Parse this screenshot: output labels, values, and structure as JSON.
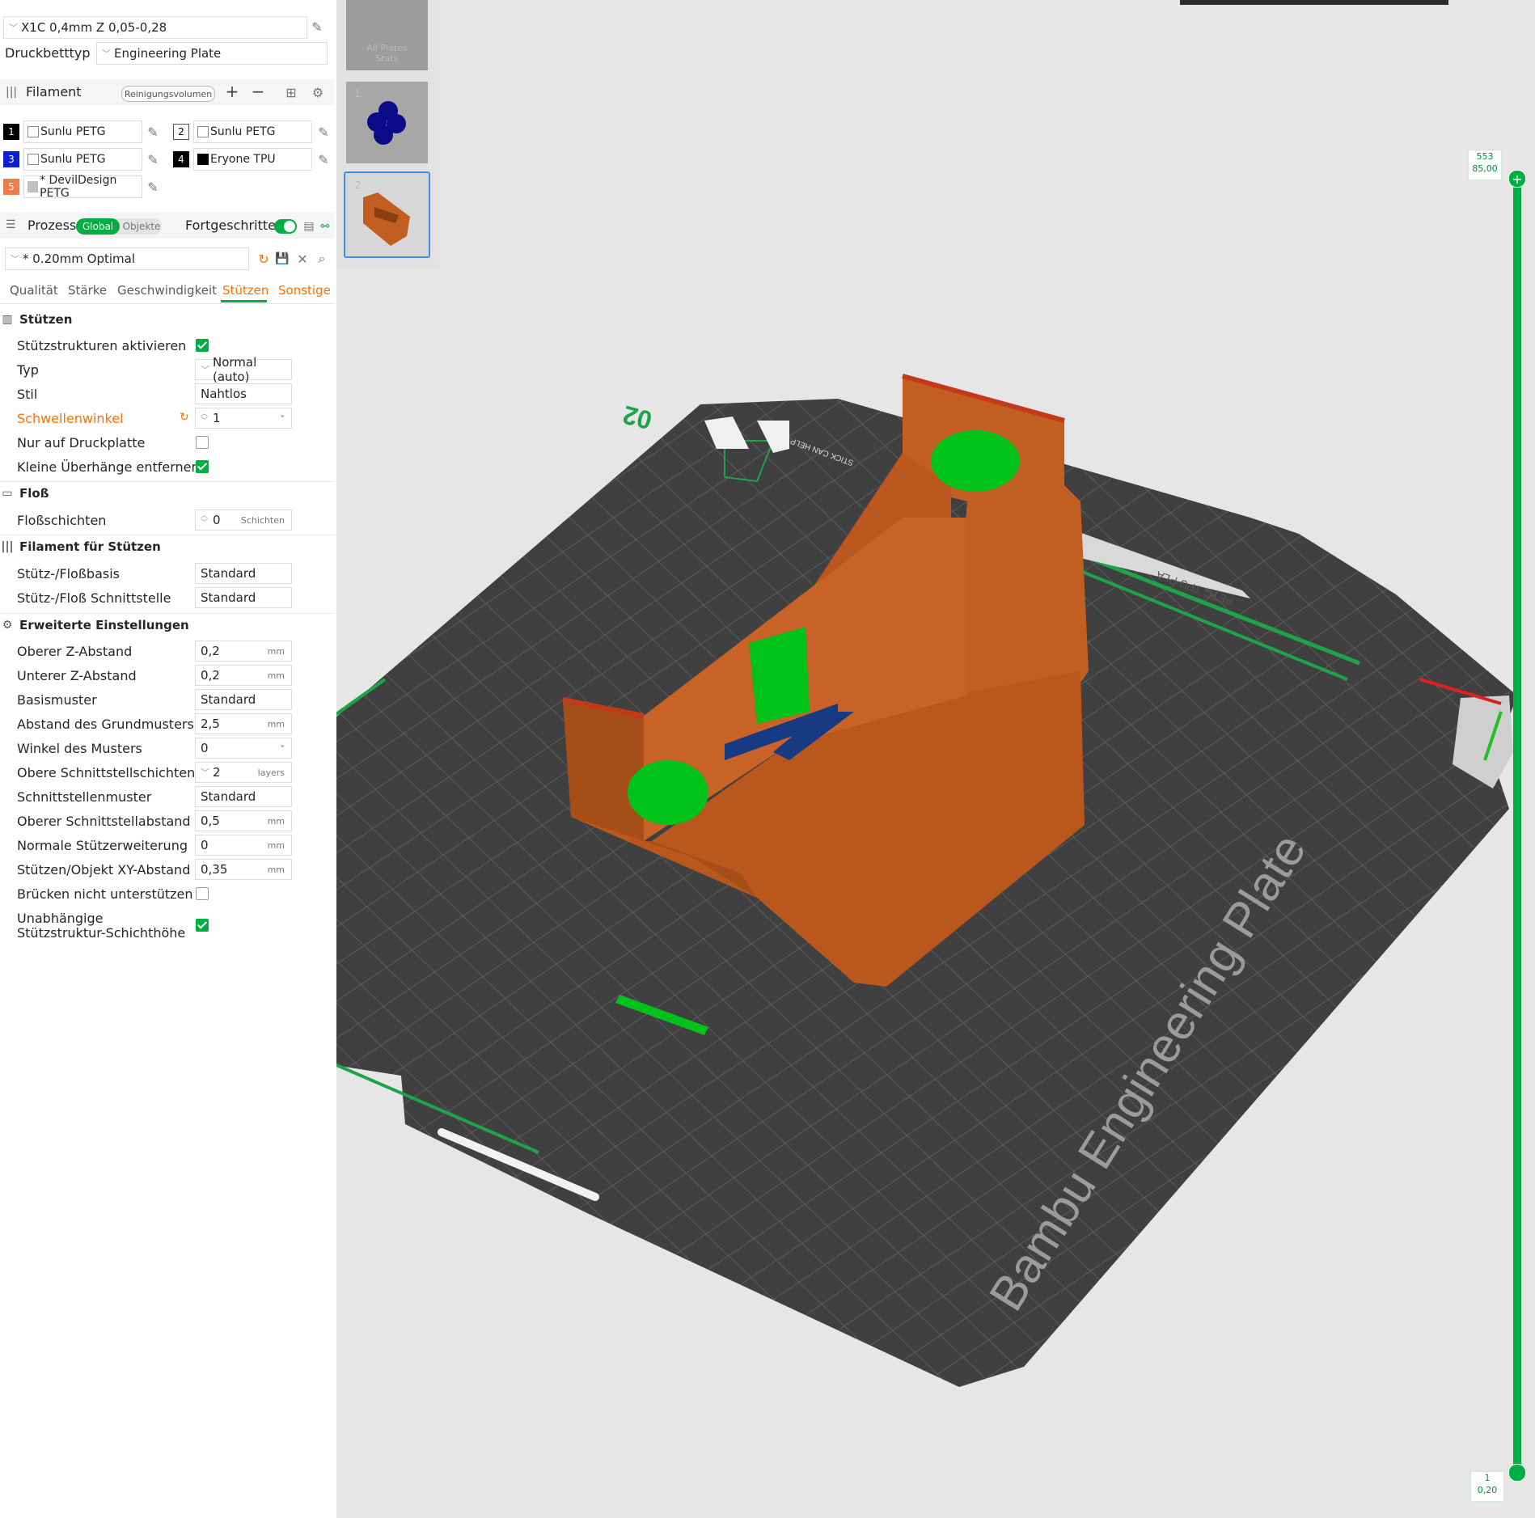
{
  "printer": {
    "profile": "X1C 0,4mm Z 0,05-0,28"
  },
  "bed": {
    "label": "Druckbetttyp",
    "value": "Engineering Plate"
  },
  "filament": {
    "title": "Filament",
    "purge_button": "Reinigungsvolumen",
    "slots": [
      {
        "num": "1",
        "name": "Sunlu PETG",
        "num_color": "#000000",
        "swatch": "#ffffff"
      },
      {
        "num": "2",
        "name": "Sunlu PETG",
        "num_color": "#ffffff",
        "swatch": "#ffffff"
      },
      {
        "num": "3",
        "name": "Sunlu PETG",
        "num_color": "#0a1fd6",
        "swatch": "#ffffff"
      },
      {
        "num": "4",
        "name": "Eryone TPU",
        "num_color": "#000000",
        "swatch": "#000000"
      },
      {
        "num": "5",
        "name": "* DevilDesign PETG",
        "num_color": "#ee7d4e",
        "swatch": "#c0c0c0"
      }
    ]
  },
  "process": {
    "title": "Prozess",
    "toggle_global": "Global",
    "toggle_objects": "Objekte",
    "advanced_label": "Fortgeschritten",
    "preset": "* 0.20mm Optimal",
    "tabs": [
      "Qualität",
      "Stärke",
      "Geschwindigkeit",
      "Stützen",
      "Sonstige"
    ],
    "active_tab": "Stützen"
  },
  "sections": {
    "support": {
      "title": "Stützen",
      "enable": "Stützstrukturen aktivieren",
      "type_label": "Typ",
      "type_value": "Normal (auto)",
      "style_label": "Stil",
      "style_value": "Nahtlos",
      "threshold_label": "Schwellenwinkel",
      "threshold_value": "1",
      "threshold_unit": "°",
      "only_plate": "Nur auf Druckplatte",
      "remove_small": "Kleine Überhänge entfernen"
    },
    "raft": {
      "title": "Floß",
      "layers_label": "Floßschichten",
      "layers_value": "0",
      "layers_unit": "Schichten"
    },
    "support_filament": {
      "title": "Filament für Stützen",
      "base_label": "Stütz-/Floßbasis",
      "base_value": "Standard",
      "interface_label": "Stütz-/Floß Schnittstelle",
      "interface_value": "Standard"
    },
    "advanced": {
      "title": "Erweiterte Einstellungen",
      "rows": [
        {
          "label": "Oberer Z-Abstand",
          "value": "0,2",
          "unit": "mm"
        },
        {
          "label": "Unterer Z-Abstand",
          "value": "0,2",
          "unit": "mm"
        },
        {
          "label": "Basismuster",
          "value": "Standard",
          "unit": ""
        },
        {
          "label": "Abstand des Grundmusters",
          "value": "2,5",
          "unit": "mm"
        },
        {
          "label": "Winkel des Musters",
          "value": "0",
          "unit": "°"
        },
        {
          "label": "Obere Schnittstellschichten",
          "value": "2",
          "unit": "layers"
        },
        {
          "label": "Schnittstellenmuster",
          "value": "Standard",
          "unit": ""
        },
        {
          "label": "Oberer Schnittstellabstand",
          "value": "0,5",
          "unit": "mm"
        },
        {
          "label": "Normale Stützerweiterung",
          "value": "0",
          "unit": "mm"
        },
        {
          "label": "Stützen/Objekt XY-Abstand",
          "value": "0,35",
          "unit": "mm"
        }
      ],
      "no_bridge": "Brücken nicht unterstützen",
      "independent_1": "Unabhängige",
      "independent_2": "Stützstruktur-Schichthöhe"
    }
  },
  "plates": {
    "all_stats": "All Plates Stats",
    "plate1": "1",
    "plate2": "2"
  },
  "viewport": {
    "plate_number": "02",
    "plate_name": "Bambu Engineering Plate",
    "sticker_text": "PETG TPU PLA",
    "sticker_text2": "STICK CAN HELP"
  },
  "layer_slider": {
    "top_layer": "553",
    "top_height": "85,00",
    "bottom_layer": "1",
    "bottom_height": "0,20"
  },
  "colors": {
    "accent": "#00ae42",
    "orange": "#ff6f00",
    "model": "#c25e22",
    "support": "#00c21a"
  }
}
